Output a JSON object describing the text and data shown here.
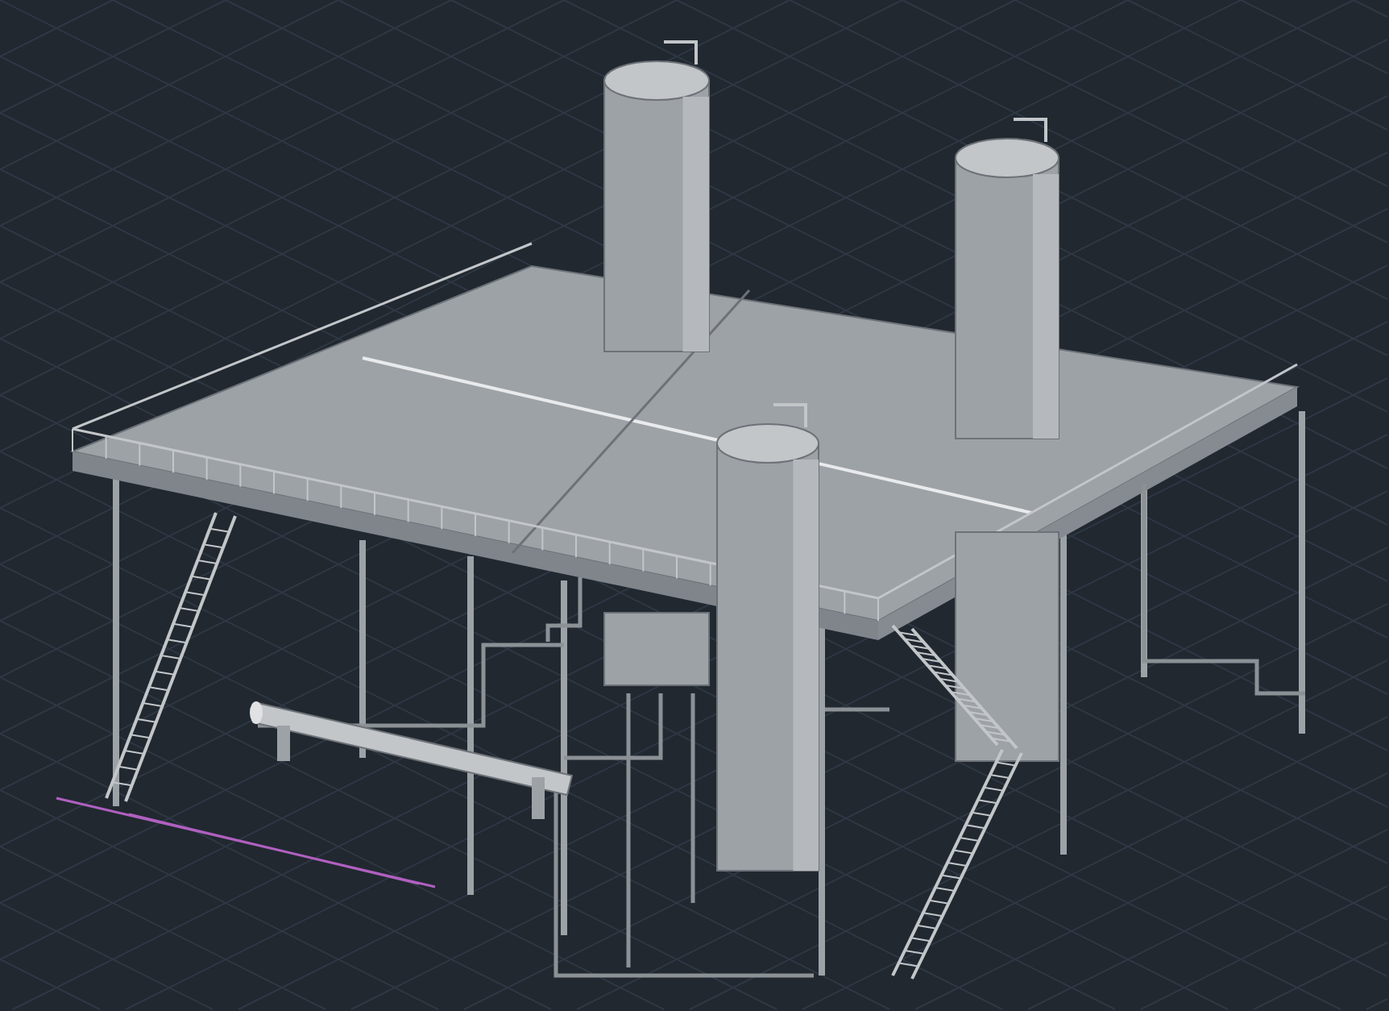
{
  "viewport": {
    "grid": true
  },
  "objects": [
    {
      "kind": "platform"
    },
    {
      "kind": "vessel"
    },
    {
      "kind": "vessel"
    },
    {
      "kind": "vessel"
    },
    {
      "kind": "exchanger"
    },
    {
      "kind": "stair"
    },
    {
      "kind": "stair"
    },
    {
      "kind": "stair"
    }
  ]
}
